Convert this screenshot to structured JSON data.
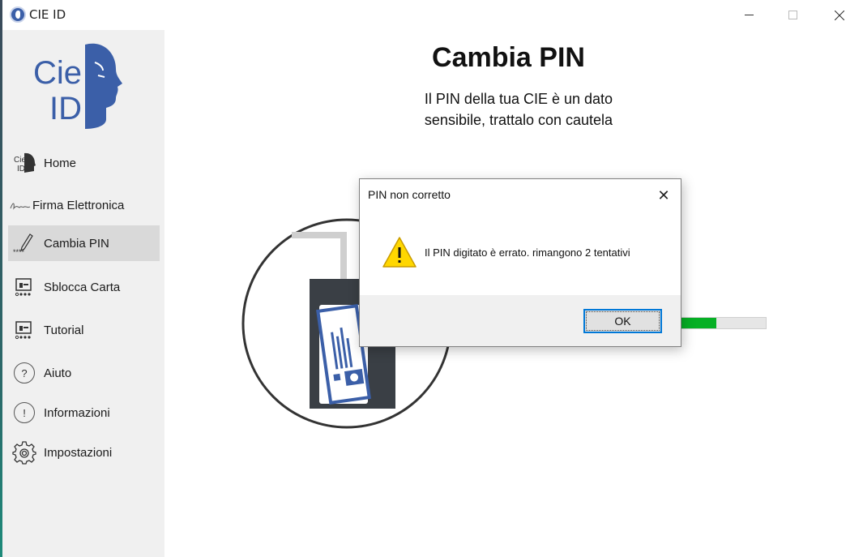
{
  "window": {
    "title": "CIE ID"
  },
  "sidebar": {
    "logo_text_1": "Cie",
    "logo_text_2": "ID",
    "items": [
      {
        "label": "Home",
        "icon": "cie-id-icon"
      },
      {
        "label": "Firma Elettronica",
        "icon": "signature-icon"
      },
      {
        "label": "Cambia PIN",
        "icon": "pencil-pin-icon",
        "active": true
      },
      {
        "label": "Sblocca Carta",
        "icon": "unlock-card-icon"
      },
      {
        "label": "Tutorial",
        "icon": "tutorial-icon"
      },
      {
        "label": "Aiuto",
        "icon": "help-icon"
      },
      {
        "label": "Informazioni",
        "icon": "info-icon"
      },
      {
        "label": "Impostazioni",
        "icon": "gear-icon"
      }
    ]
  },
  "main": {
    "title": "Cambia PIN",
    "subtitle_line1": "Il PIN della tua CIE è un dato",
    "subtitle_line2": "sensibile,  trattalo con cautela",
    "progress_fraction": 0.42,
    "progress_color": "#06b025"
  },
  "dialog": {
    "title": "PIN non corretto",
    "message": "Il PIN digitato è errato. rimangono 2 tentativi",
    "ok_label": "OK",
    "close_glyph": "✕",
    "warning_icon": "warning-icon"
  },
  "colors": {
    "brand": "#3b5fa8",
    "accent": "#0078d7"
  }
}
